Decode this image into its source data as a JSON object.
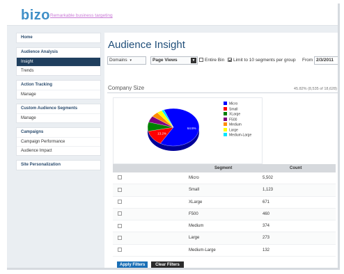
{
  "brand": {
    "logo": "bizo",
    "tagline": "Remarkable business targeting"
  },
  "sidebar": {
    "groups": [
      {
        "items": [
          {
            "label": "Home",
            "head": true
          }
        ]
      },
      {
        "items": [
          {
            "label": "Audience Analysis",
            "head": true
          },
          {
            "label": "Insight",
            "active": true
          },
          {
            "label": "Trends"
          }
        ]
      },
      {
        "items": [
          {
            "label": "Action Tracking",
            "head": true
          },
          {
            "label": "Manage"
          }
        ]
      },
      {
        "items": [
          {
            "label": "Custom Audience Segments",
            "head": true
          },
          {
            "label": "Manage"
          }
        ]
      },
      {
        "items": [
          {
            "label": "Campaigns",
            "head": true
          },
          {
            "label": "Campaign Performance"
          },
          {
            "label": "Audience Impact"
          }
        ]
      },
      {
        "items": [
          {
            "label": "Site Personalization",
            "head": true
          }
        ]
      }
    ]
  },
  "main": {
    "title": "Audience Insight",
    "toolbar": {
      "domains_label": "Domains",
      "metric_value": "Page Views",
      "entire_bin_label": "Entire Bin",
      "limit_label": "Limit to 10 segments per group",
      "from_label": "From",
      "from_date": "2/3/2011"
    },
    "section": {
      "title": "Company Size",
      "summary": "45.82% (8,535 of 18,628)"
    },
    "table": {
      "col_segment": "Segment",
      "col_count": "Count",
      "rows": [
        {
          "segment": "Micro",
          "count": "5,502"
        },
        {
          "segment": "Small",
          "count": "1,123"
        },
        {
          "segment": "XLarge",
          "count": "671"
        },
        {
          "segment": "F500",
          "count": "460"
        },
        {
          "segment": "Medium",
          "count": "374"
        },
        {
          "segment": "Large",
          "count": "273"
        },
        {
          "segment": "Medium-Large",
          "count": "132"
        }
      ]
    },
    "buttons": {
      "apply": "Apply Filters",
      "clear": "Clear Filters"
    }
  },
  "chart_data": {
    "type": "pie",
    "series": [
      {
        "name": "Micro",
        "value": 5502,
        "color": "#0000ff"
      },
      {
        "name": "Small",
        "value": 1123,
        "color": "#ff0000"
      },
      {
        "name": "XLarge",
        "value": 671,
        "color": "#008000"
      },
      {
        "name": "F500",
        "value": 460,
        "color": "#800080"
      },
      {
        "name": "Medium",
        "value": 374,
        "color": "#ff8c00"
      },
      {
        "name": "Large",
        "value": 273,
        "color": "#ffff00"
      },
      {
        "name": "Medium-Large",
        "value": 132,
        "color": "#00e5ff"
      }
    ],
    "data_labels": [
      "64.5%",
      "13.2%"
    ],
    "legend_position": "right"
  }
}
